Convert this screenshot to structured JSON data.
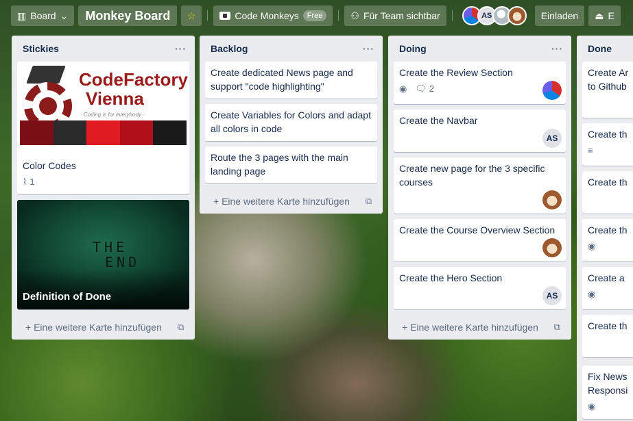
{
  "header": {
    "board_switcher": "Board",
    "board_title": "Monkey Board",
    "workspace": "Code Monkeys",
    "workspace_plan": "Free",
    "visibility": "Für Team sichtbar",
    "member_initials": "AS",
    "invite": "Einladen",
    "overflow_initial": "E"
  },
  "add_card_label": "+ Eine weitere Karte hinzufügen",
  "lists": [
    {
      "title": "Stickies",
      "cards": [
        {
          "title": "Color Codes",
          "cover_logo_line1": "CodeFactory",
          "cover_logo_line2": "Vienna",
          "cover_logo_sub": "- Coding is for everybody -",
          "attachments": "1",
          "swatches": [
            "#7a1016",
            "#2b2b2b",
            "#e01b22",
            "#b0101a",
            "#1a1a1a"
          ]
        },
        {
          "title": "Definition of Done",
          "cover_text_line1": "THE",
          "cover_text_line2": "END"
        }
      ]
    },
    {
      "title": "Backlog",
      "cards": [
        {
          "title": "Create dedicated News page and support \"code highlighting\""
        },
        {
          "title": "Create Variables for Colors and adapt all colors in code"
        },
        {
          "title": "Route the 3 pages with the main landing page"
        }
      ]
    },
    {
      "title": "Doing",
      "cards": [
        {
          "title": "Create the Review Section",
          "comments": "2",
          "member": "img"
        },
        {
          "title": "Create the Navbar",
          "member": "AS"
        },
        {
          "title": "Create new page for the 3 specific courses",
          "member": "dog"
        },
        {
          "title": "Create the Course Overview Section",
          "member": "dog"
        },
        {
          "title": "Create the Hero Section",
          "member": "AS"
        }
      ]
    },
    {
      "title": "Done",
      "cards": [
        {
          "title": "Create Ar to Github"
        },
        {
          "title": "Create th"
        },
        {
          "title": "Create th"
        },
        {
          "title": "Create th"
        },
        {
          "title": "Create a"
        },
        {
          "title": "Create th"
        },
        {
          "title": "Fix News Responsi"
        }
      ]
    }
  ],
  "colors": {
    "list_bg": "#ebecf0",
    "brand_red": "#9b1b1b",
    "text": "#172b4d",
    "subtle": "#5e6c84"
  }
}
